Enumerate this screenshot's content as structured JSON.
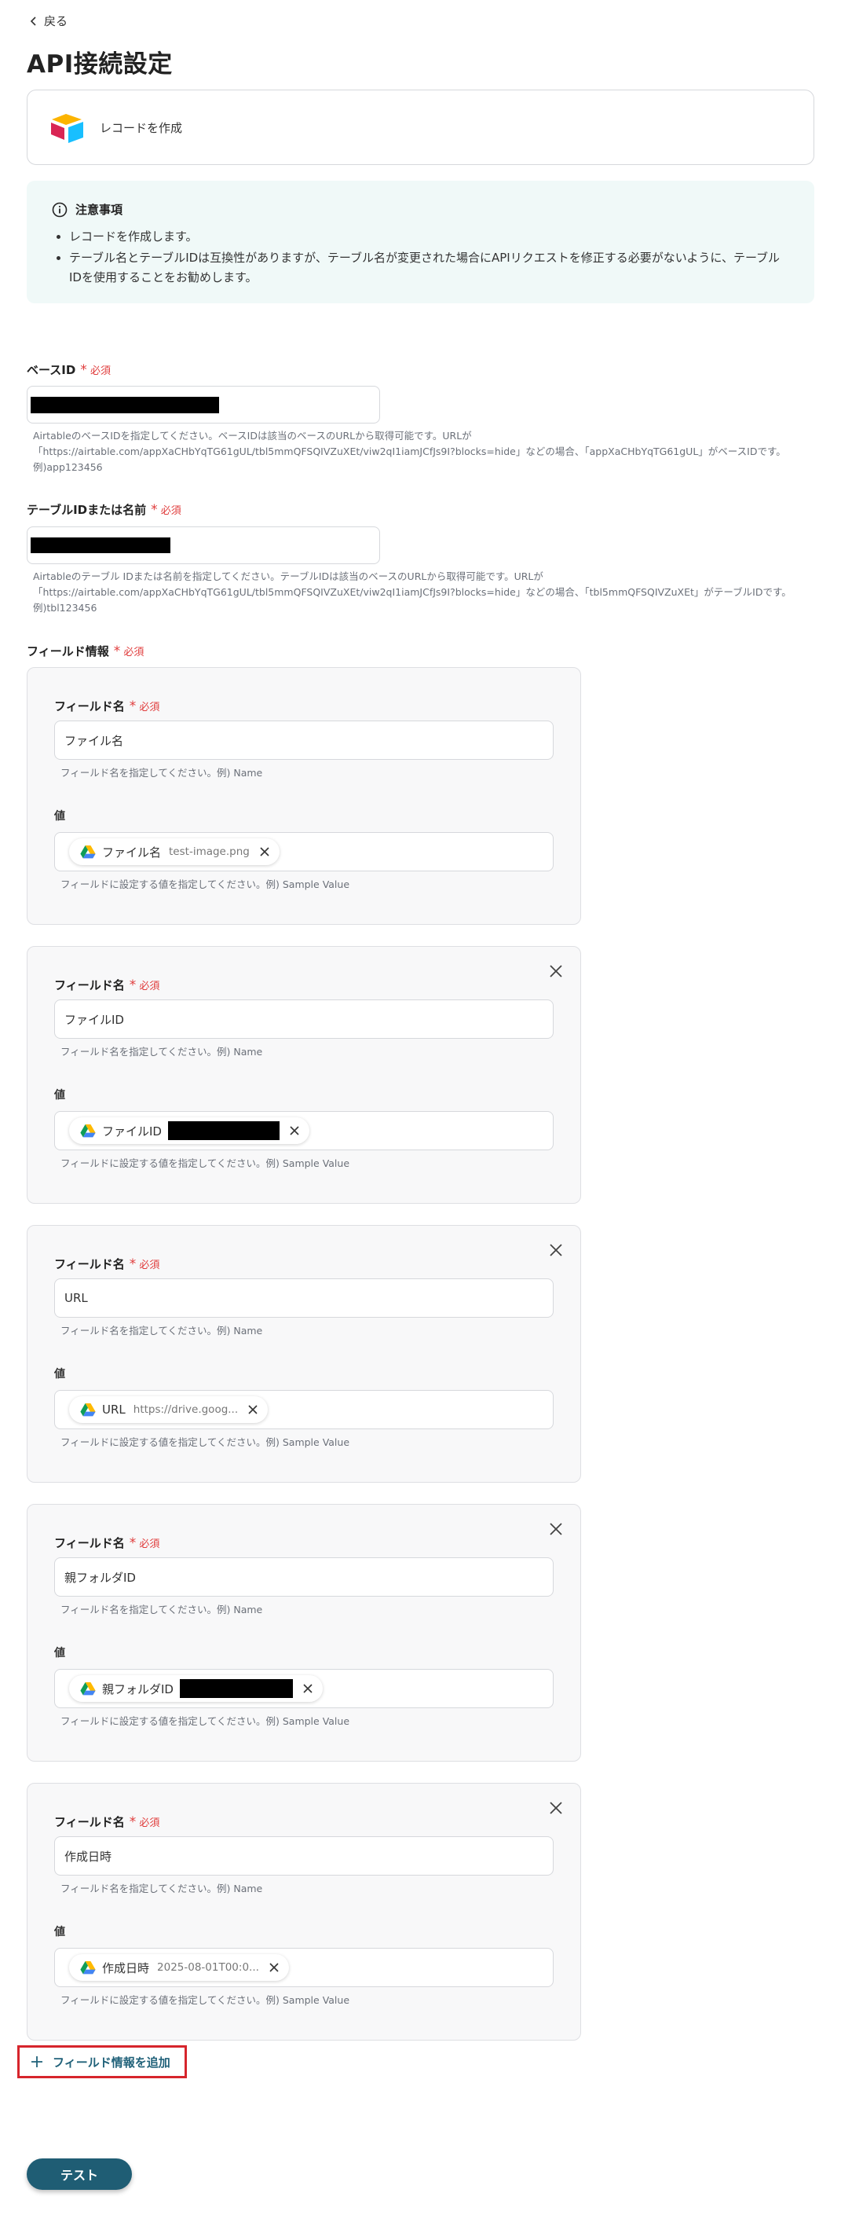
{
  "nav": {
    "back_label": "戻る"
  },
  "page_title": "API接続設定",
  "app": {
    "action_label": "レコードを作成",
    "logo_icon": "airtable-logo"
  },
  "notice": {
    "title": "注意事項",
    "items": [
      "レコードを作成します。",
      "テーブル名とテーブルIDは互換性がありますが、テーブル名が変更された場合にAPIリクエストを修正する必要がないように、テーブルIDを使用することをお勧めします。"
    ]
  },
  "required_label": "必須",
  "base_id": {
    "label": "ベースID",
    "help": "AirtableのベースIDを指定してください。ベースIDは該当のベースのURLから取得可能です。URLが「https://airtable.com/appXaCHbYqTG61gUL/tbl5mmQFSQIVZuXEt/viw2qI1iamJCfJs9I?blocks=hide」などの場合、「appXaCHbYqTG61gUL」がベースIDです。例)app123456"
  },
  "table_id": {
    "label": "テーブルIDまたは名前",
    "help": "Airtableのテーブル IDまたは名前を指定してください。テーブルIDは該当のベースのURLから取得可能です。URLが「https://airtable.com/appXaCHbYqTG61gUL/tbl5mmQFSQIVZuXEt/viw2qI1iamJCfJs9I?blocks=hide」などの場合、「tbl5mmQFSQIVZuXEt」がテーブルIDです。例)tbl123456"
  },
  "fields_section": {
    "label": "フィールド情報",
    "name_label": "フィールド名",
    "name_help": "フィールド名を指定してください。例) Name",
    "value_label": "値",
    "value_help": "フィールドに設定する値を指定してください。例) Sample Value",
    "items": [
      {
        "name": "ファイル名",
        "chip_label": "ファイル名",
        "chip_value": "test-image.png"
      },
      {
        "name": "ファイルID",
        "chip_label": "ファイルID",
        "chip_value": ""
      },
      {
        "name": "URL",
        "chip_label": "URL",
        "chip_value": "https://drive.goog..."
      },
      {
        "name": "親フォルダID",
        "chip_label": "親フォルダID",
        "chip_value": ""
      },
      {
        "name": "作成日時",
        "chip_label": "作成日時",
        "chip_value": "2025-08-01T00:0..."
      }
    ]
  },
  "add_field_label": "フィールド情報を追加",
  "test_button_label": "テスト"
}
